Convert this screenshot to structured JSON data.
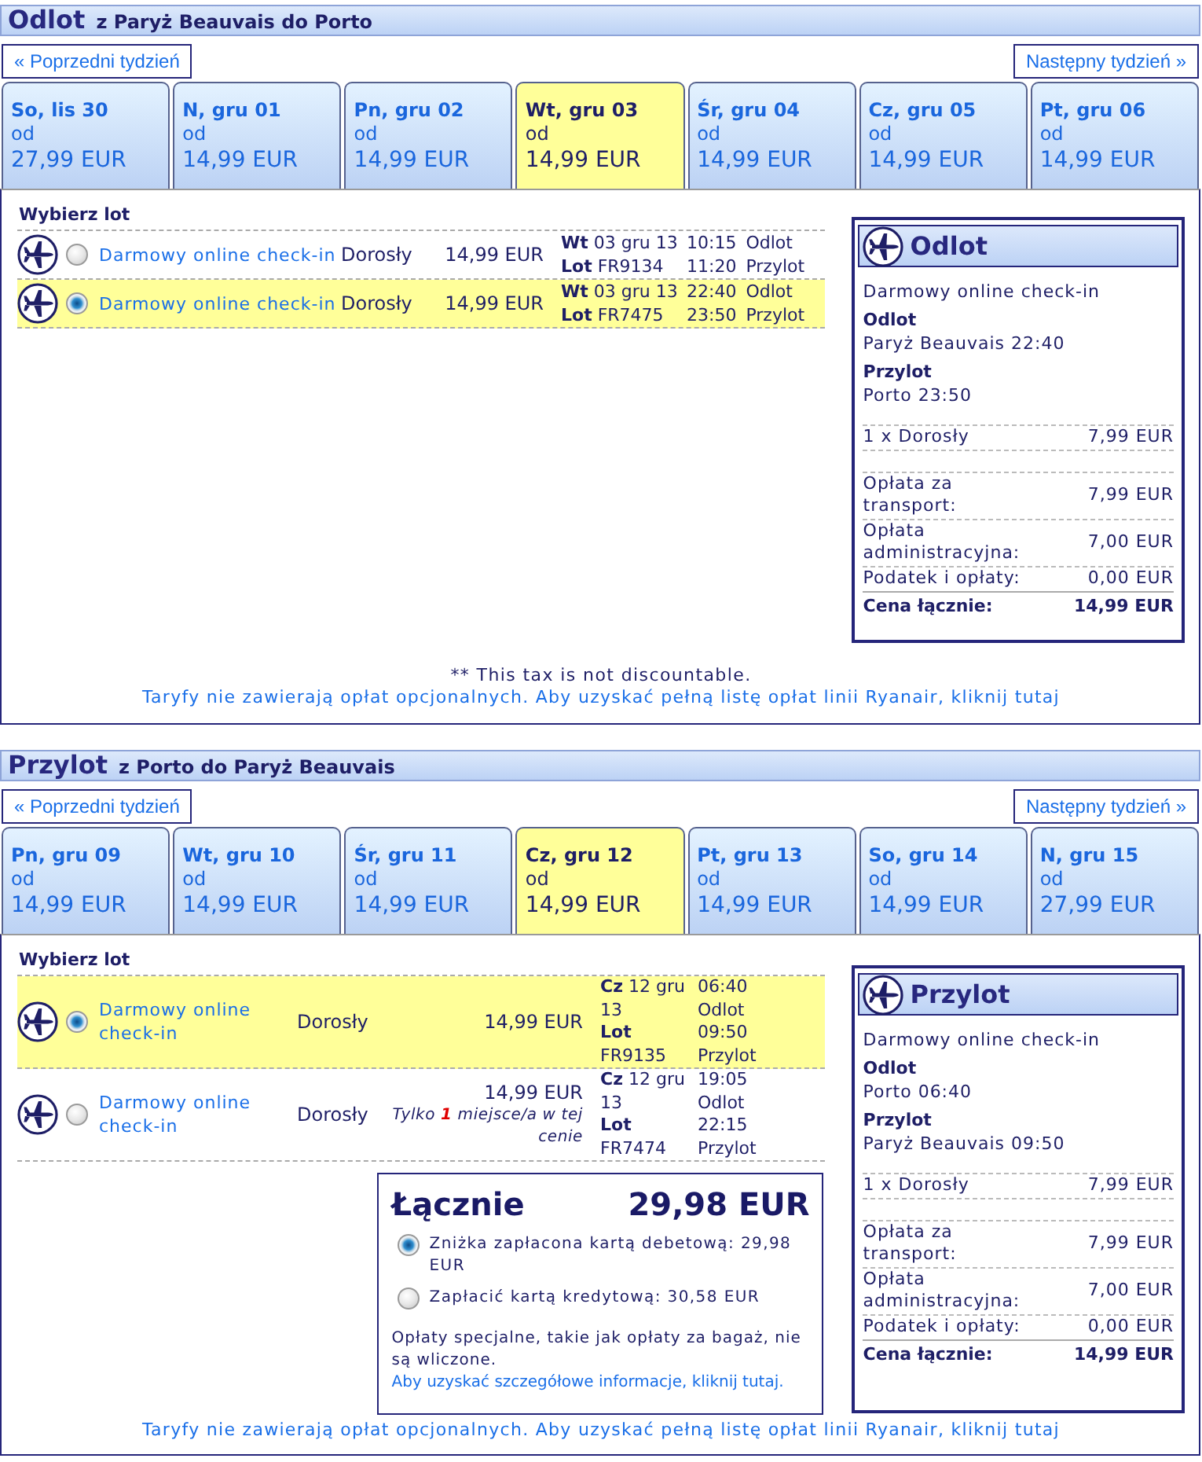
{
  "sections": [
    {
      "title": "Odlot",
      "route": "z Paryż Beauvais do Porto",
      "prev_week": "« Poprzedni tydzień",
      "next_week": "Następny tydzień »",
      "days": [
        {
          "label": "So, lis 30",
          "from": "od",
          "price": "27,99 EUR",
          "selected": false
        },
        {
          "label": "N, gru 01",
          "from": "od",
          "price": "14,99 EUR",
          "selected": false
        },
        {
          "label": "Pn, gru 02",
          "from": "od",
          "price": "14,99 EUR",
          "selected": false
        },
        {
          "label": "Wt, gru 03",
          "from": "od",
          "price": "14,99 EUR",
          "selected": true
        },
        {
          "label": "Śr, gru 04",
          "from": "od",
          "price": "14,99 EUR",
          "selected": false
        },
        {
          "label": "Cz, gru 05",
          "from": "od",
          "price": "14,99 EUR",
          "selected": false
        },
        {
          "label": "Pt, gru 06",
          "from": "od",
          "price": "14,99 EUR",
          "selected": false
        }
      ],
      "heading": "Wybierz lot",
      "flights": [
        {
          "checkin": "Darmowy online check-in",
          "passenger": "Dorosły",
          "price": "14,99 EUR",
          "date": "**Wt** 03 gru 13",
          "flight": "**Lot** FR9134",
          "dep_time": "10:15",
          "dep_label": "Odlot",
          "arr_time": "11:20",
          "arr_label": "Przylot",
          "selected": false
        },
        {
          "checkin": "Darmowy online check-in",
          "passenger": "Dorosły",
          "price": "14,99 EUR",
          "date": "**Wt** 03 gru 13",
          "flight": "**Lot** FR7475",
          "dep_time": "22:40",
          "dep_label": "Odlot",
          "arr_time": "23:50",
          "arr_label": "Przylot",
          "selected": true
        }
      ],
      "summary": {
        "title": "Odlot",
        "checkin": "Darmowy online check-in",
        "departure": {
          "label": "Odlot",
          "value": "Paryż Beauvais 22:40"
        },
        "arrival": {
          "label": "Przylot",
          "value": "Porto 23:50"
        },
        "fares": [
          {
            "label": "1 x Dorosły",
            "value": "7,99 EUR"
          }
        ],
        "fees": [
          {
            "label": "Opłata za transport:",
            "value": "7,99 EUR"
          },
          {
            "label": "Opłata administracyjna:",
            "value": "7,00 EUR"
          },
          {
            "label": "Podatek i opłaty:",
            "value": "0,00 EUR"
          }
        ],
        "total": {
          "label": "Cena łącznie:",
          "value": "14,99 EUR"
        }
      },
      "footnote": "** This tax is not discountable.",
      "fares_link": "Taryfy nie zawierają opłat opcjonalnych. Aby uzyskać pełną listę opłat linii Ryanair, kliknij tutaj"
    },
    {
      "title": "Przylot",
      "route": "z Porto do Paryż Beauvais",
      "prev_week": "« Poprzedni tydzień",
      "next_week": "Następny tydzień »",
      "days": [
        {
          "label": "Pn, gru 09",
          "from": "od",
          "price": "14,99 EUR",
          "selected": false
        },
        {
          "label": "Wt, gru 10",
          "from": "od",
          "price": "14,99 EUR",
          "selected": false
        },
        {
          "label": "Śr, gru 11",
          "from": "od",
          "price": "14,99 EUR",
          "selected": false
        },
        {
          "label": "Cz, gru 12",
          "from": "od",
          "price": "14,99 EUR",
          "selected": true
        },
        {
          "label": "Pt, gru 13",
          "from": "od",
          "price": "14,99 EUR",
          "selected": false
        },
        {
          "label": "So, gru 14",
          "from": "od",
          "price": "14,99 EUR",
          "selected": false
        },
        {
          "label": "N, gru 15",
          "from": "od",
          "price": "27,99 EUR",
          "selected": false
        }
      ],
      "heading": "Wybierz lot",
      "flights": [
        {
          "checkin": "Darmowy online check-in",
          "passenger": "Dorosły",
          "price": "14,99 EUR",
          "date": "**Cz** 12 gru 13",
          "flight": "**Lot** FR9135",
          "dep_time": "06:40",
          "dep_label": "Odlot",
          "arr_time": "09:50",
          "arr_label": "Przylot",
          "selected": true
        },
        {
          "checkin": "Darmowy online check-in",
          "passenger": "Dorosły",
          "price": "14,99 EUR",
          "note": "Tylko **1** miejsce/a w tej cenie",
          "date": "**Cz** 12 gru 13",
          "flight": "**Lot** FR7474",
          "dep_time": "19:05",
          "dep_label": "Odlot",
          "arr_time": "22:15",
          "arr_label": "Przylot",
          "selected": false
        }
      ],
      "total_box": {
        "label": "Łącznie",
        "amount": "29,98 EUR",
        "payment_options": [
          {
            "text": "Zniżka zapłacona kartą debetową: 29,98 EUR",
            "selected": true
          },
          {
            "text": "Zapłacić kartą kredytową: 30,58 EUR",
            "selected": false
          }
        ],
        "info": "Opłaty specjalne, takie jak opłaty za bagaż, nie są wliczone.",
        "info_link": "Aby uzyskać szczegółowe informacje, kliknij tutaj."
      },
      "summary": {
        "title": "Przylot",
        "checkin": "Darmowy online check-in",
        "departure": {
          "label": "Odlot",
          "value": "Porto 06:40"
        },
        "arrival": {
          "label": "Przylot",
          "value": "Paryż Beauvais 09:50"
        },
        "fares": [
          {
            "label": "1 x Dorosły",
            "value": "7,99 EUR"
          }
        ],
        "fees": [
          {
            "label": "Opłata za transport:",
            "value": "7,99 EUR"
          },
          {
            "label": "Opłata administracyjna:",
            "value": "7,00 EUR"
          },
          {
            "label": "Podatek i opłaty:",
            "value": "0,00 EUR"
          }
        ],
        "total": {
          "label": "Cena łącznie:",
          "value": "14,99 EUR"
        }
      },
      "fares_link": "Taryfy nie zawierają opłat opcjonalnych. Aby uzyskać pełną listę opłat linii Ryanair, kliknij tutaj"
    }
  ]
}
